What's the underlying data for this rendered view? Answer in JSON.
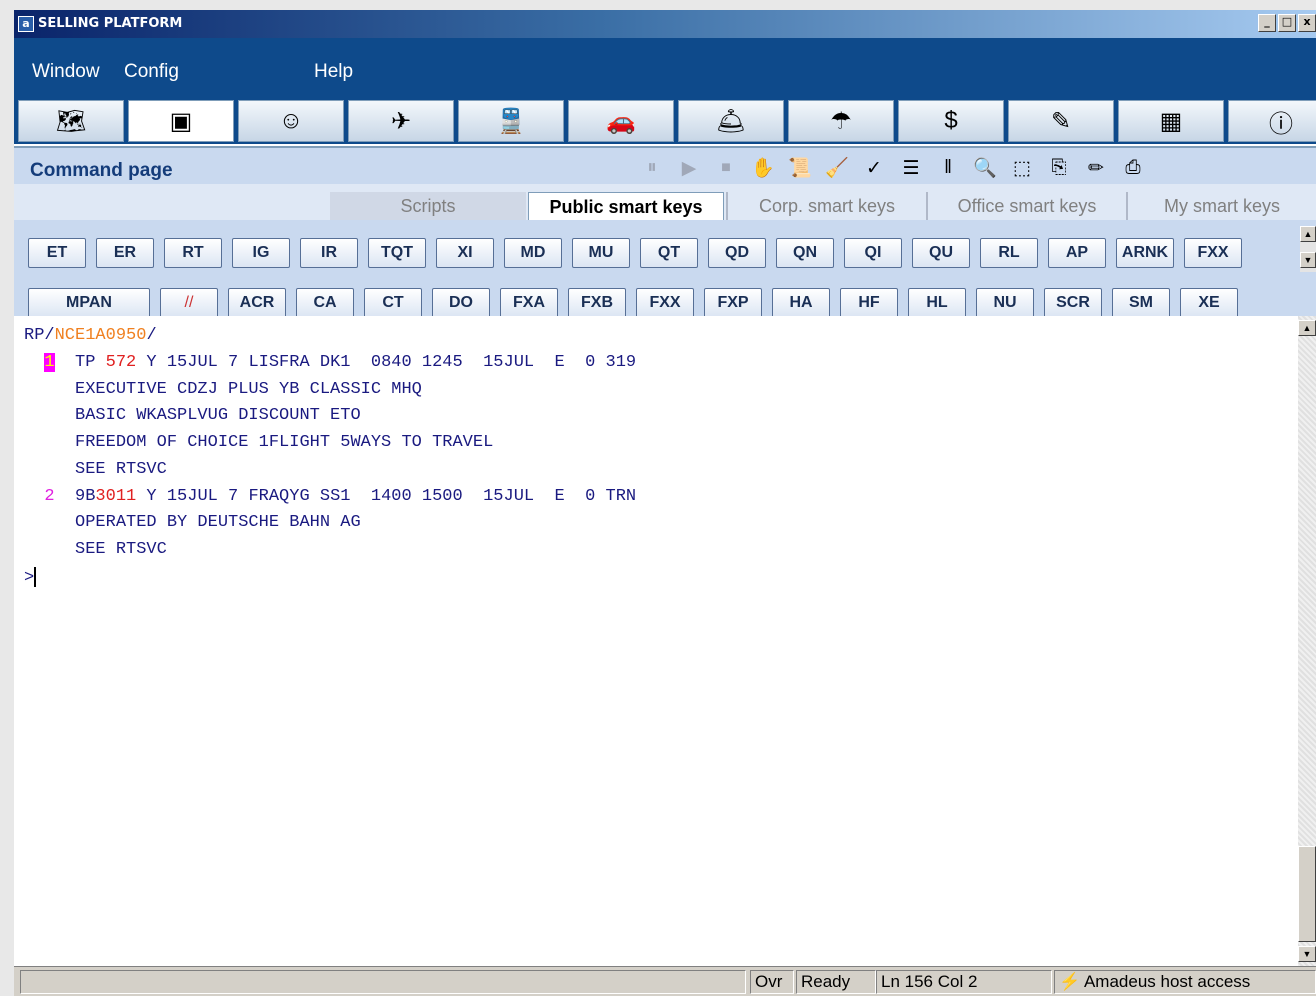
{
  "window": {
    "logo_letter": "a",
    "title": "SELLING PLATFORM",
    "controls": [
      "_",
      "□",
      "x"
    ]
  },
  "menu": {
    "window": "Window",
    "config": "Config",
    "help": "Help"
  },
  "iconbar": [
    {
      "name": "map-icon",
      "glyph": "🗺"
    },
    {
      "name": "terminal-icon",
      "glyph": "▣"
    },
    {
      "name": "agent-icon",
      "glyph": "☺"
    },
    {
      "name": "plane-icon",
      "glyph": "✈"
    },
    {
      "name": "train-icon",
      "glyph": "🚆"
    },
    {
      "name": "car-icon",
      "glyph": "🚗"
    },
    {
      "name": "bellboy-icon",
      "glyph": "🛎"
    },
    {
      "name": "umbrella-icon",
      "glyph": "☂"
    },
    {
      "name": "money-icon",
      "glyph": "$"
    },
    {
      "name": "checklist-icon",
      "glyph": "✎"
    },
    {
      "name": "building-icon",
      "glyph": "▦"
    },
    {
      "name": "info-icon",
      "glyph": "ⓘ"
    }
  ],
  "command_page": {
    "title": "Command page",
    "tools": [
      {
        "name": "pause-icon",
        "glyph": "⏸"
      },
      {
        "name": "play-icon",
        "glyph": "▶"
      },
      {
        "name": "stop-icon",
        "glyph": "⏹"
      },
      {
        "name": "pointer-icon",
        "glyph": "✋"
      },
      {
        "name": "scroll-icon",
        "glyph": "📜"
      },
      {
        "name": "broom-icon",
        "glyph": "🧹"
      },
      {
        "name": "record-icon",
        "glyph": "✓"
      },
      {
        "name": "list-icon",
        "glyph": "☰"
      },
      {
        "name": "columns-icon",
        "glyph": "‖"
      },
      {
        "name": "search-icon",
        "glyph": "🔍"
      },
      {
        "name": "select-icon",
        "glyph": "⬚"
      },
      {
        "name": "copy-icon",
        "glyph": "⎘"
      },
      {
        "name": "edit-icon",
        "glyph": "✏"
      },
      {
        "name": "print-icon",
        "glyph": "⎙"
      }
    ]
  },
  "tabs": [
    "Scripts",
    "Public smart keys",
    "Corp. smart keys",
    "Office smart keys",
    "My smart keys"
  ],
  "smart_keys_row1": [
    "ET",
    "ER",
    "RT",
    "IG",
    "IR",
    "TQT",
    "XI",
    "MD",
    "MU",
    "QT",
    "QD",
    "QN",
    "QI",
    "QU",
    "RL",
    "AP",
    "ARNK",
    "FXX"
  ],
  "smart_keys_row2": [
    "MPAN",
    "//",
    "ACR",
    "CA",
    "CT",
    "DO",
    "FXA",
    "FXB",
    "FXX",
    "FXP",
    "HA",
    "HF",
    "HL",
    "NU",
    "SCR",
    "SM",
    "XE"
  ],
  "terminal": {
    "rp_prefix": "RP/",
    "office_id": "NCE1A0950",
    "rp_suffix": "/",
    "seg1_num": "1",
    "seg1_a": "  TP ",
    "seg1_flight": "572",
    "seg1_b": " Y 15JUL 7 LISFRA DK1  0840 1245  15JUL  E  0 319",
    "seg1_l2": "     EXECUTIVE CDZJ PLUS YB CLASSIC MHQ",
    "seg1_l3": "     BASIC WKASPLVUG DISCOUNT ETO",
    "seg1_l4": "     FREEDOM OF CHOICE 1FLIGHT 5WAYS TO TRAVEL",
    "seg1_l5": "     SEE RTSVC",
    "seg2_num": "  2",
    "seg2_a": "  9B",
    "seg2_flight": "3011",
    "seg2_b": " Y 15JUL 7 FRAQYG SS1  1400 1500  15JUL  E  0 TRN",
    "seg2_l2": "     OPERATED BY DEUTSCHE BAHN AG",
    "seg2_l3": "     SEE RTSVC",
    "prompt": ">"
  },
  "status": {
    "ovr": "Ovr",
    "ready": "Ready",
    "position": "Ln 156 Col 2",
    "host": "Amadeus host access"
  }
}
